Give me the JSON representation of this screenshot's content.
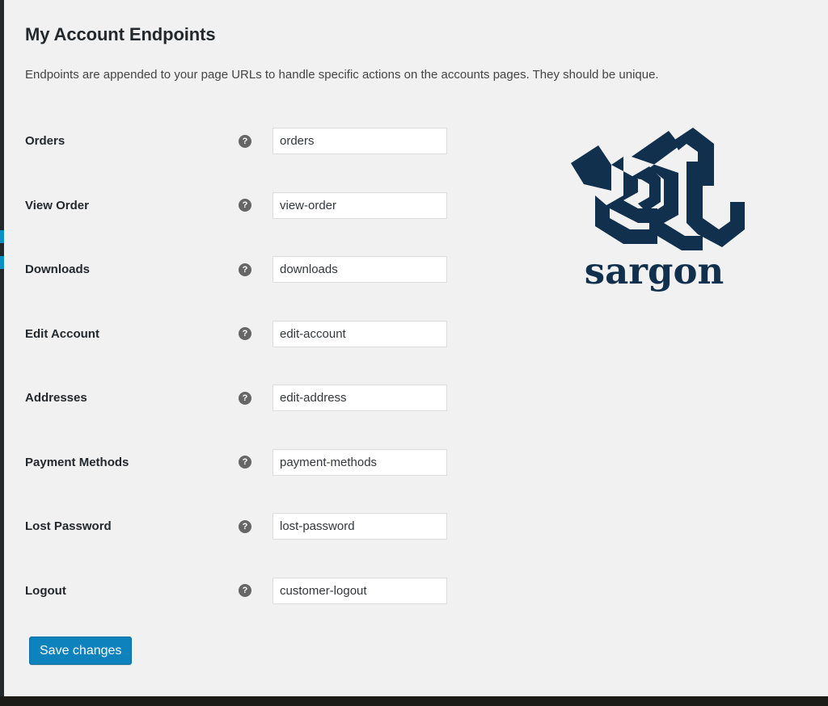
{
  "page": {
    "title": "My Account Endpoints",
    "description": "Endpoints are appended to your page URLs to handle specific actions on the accounts pages. They should be unique."
  },
  "icons": {
    "help": "?"
  },
  "endpoints": [
    {
      "label": "Orders",
      "value": "orders",
      "placeholder": "orders"
    },
    {
      "label": "View Order",
      "value": "view-order",
      "placeholder": "view-order"
    },
    {
      "label": "Downloads",
      "value": "downloads",
      "placeholder": "downloads"
    },
    {
      "label": "Edit Account",
      "value": "edit-account",
      "placeholder": "edit-account"
    },
    {
      "label": "Addresses",
      "value": "edit-address",
      "placeholder": "edit-address"
    },
    {
      "label": "Payment Methods",
      "value": "payment-methods",
      "placeholder": "payment-methods"
    },
    {
      "label": "Lost Password",
      "value": "lost-password",
      "placeholder": "lost-password"
    },
    {
      "label": "Logout",
      "value": "customer-logout",
      "placeholder": "customer-logout"
    }
  ],
  "actions": {
    "save_label": "Save changes"
  },
  "brand": {
    "wordmark": "sargon",
    "color": "#11304d"
  },
  "colors": {
    "background": "#f1f1f1",
    "admin_rail": "#23282d",
    "accent_blue": "#0d8ec6",
    "primary_button": "#0d82bd",
    "text": "#23282d",
    "help_icon": "#666666",
    "input_border": "#dddddd"
  }
}
